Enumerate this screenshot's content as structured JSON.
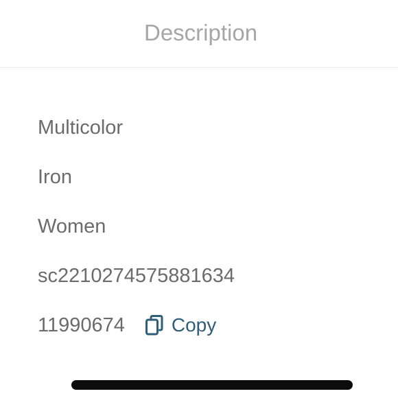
{
  "header": {
    "tab_label": "Description"
  },
  "details": {
    "color": "Multicolor",
    "material": "Iron",
    "gender": "Women",
    "sku": "sc2210274575881634",
    "product_id": "11990674",
    "copy_label": "Copy"
  },
  "colors": {
    "header_text": "#a6a6a6",
    "body_text": "#6b6b6b",
    "copy_accent": "#2f5f78",
    "divider": "#ececec"
  },
  "icons": {
    "copy": "copy-icon"
  }
}
